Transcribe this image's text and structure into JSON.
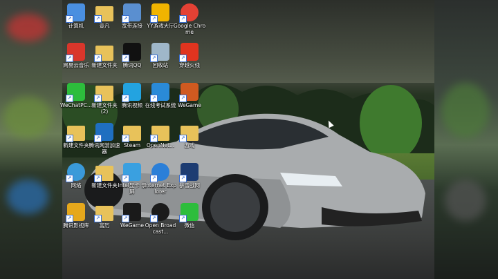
{
  "desktop": {
    "icons": [
      {
        "label": "计算机",
        "icon": "computer-icon",
        "color": "#4a8fe0"
      },
      {
        "label": "壹凡",
        "icon": "folder-icon",
        "color": "#e8c25a"
      },
      {
        "label": "宽带连接",
        "icon": "network-connection-icon",
        "color": "#5a8fd0"
      },
      {
        "label": "YY游戏大厅",
        "icon": "yy-game-icon",
        "color": "#f0b400"
      },
      {
        "label": "Google Chrome",
        "icon": "chrome-icon",
        "color": "#e44134"
      },
      {
        "label": "网易云音乐",
        "icon": "netease-music-icon",
        "color": "#d9362b"
      },
      {
        "label": "新建文件夹",
        "icon": "folder-icon",
        "color": "#e8c25a"
      },
      {
        "label": "腾讯QQ",
        "icon": "qq-penguin-icon",
        "color": "#111111"
      },
      {
        "label": "回收站",
        "icon": "recycle-bin-icon",
        "color": "#9fb7c9"
      },
      {
        "label": "穿越火线",
        "icon": "crossfire-icon",
        "color": "#e0341f"
      },
      {
        "label": "WeChatPC...",
        "icon": "wechat-icon",
        "color": "#2dbd3c"
      },
      {
        "label": "新建文件夹(2)",
        "icon": "folder-icon",
        "color": "#e8c25a"
      },
      {
        "label": "腾讯视频",
        "icon": "tencent-video-icon",
        "color": "#23a3e0"
      },
      {
        "label": "在线考试系统",
        "icon": "exam-system-icon",
        "color": "#2a8ad8"
      },
      {
        "label": "WeGame",
        "icon": "wegame-icon",
        "color": "#d05a20"
      },
      {
        "label": "新建文件夹",
        "icon": "folder-icon",
        "color": "#e8c25a"
      },
      {
        "label": "腾讯网游加速器",
        "icon": "game-accelerator-icon",
        "color": "#1f6fc0"
      },
      {
        "label": "Steam",
        "icon": "folder-icon",
        "color": "#e8c25a"
      },
      {
        "label": "OpenNet...",
        "icon": "folder-icon",
        "color": "#e8c25a"
      },
      {
        "label": "游戏",
        "icon": "folder-icon",
        "color": "#e8c25a"
      },
      {
        "label": "网络",
        "icon": "network-globe-icon",
        "color": "#3a9ad9"
      },
      {
        "label": "新建文件夹",
        "icon": "folder-icon",
        "color": "#e8c25a"
      },
      {
        "label": "Intel显卡 录屏",
        "icon": "screen-recorder-icon",
        "color": "#3aa0e0"
      },
      {
        "label": "Internet Explorer",
        "icon": "ie-icon",
        "color": "#2b7fd8"
      },
      {
        "label": "暴雪战网",
        "icon": "battlenet-icon",
        "color": "#1d3c72"
      },
      {
        "label": "腾讯影视库",
        "icon": "video-library-icon",
        "color": "#e6a81c"
      },
      {
        "label": "富历",
        "icon": "folder-icon",
        "color": "#e8c25a"
      },
      {
        "label": "WeGame",
        "icon": "wegame-icon",
        "color": "#1a1a1a"
      },
      {
        "label": "Open Broadcast...",
        "icon": "obs-icon",
        "color": "#1b1b1b"
      },
      {
        "label": "微信",
        "icon": "wechat-icon",
        "color": "#2dbd3c"
      }
    ]
  }
}
